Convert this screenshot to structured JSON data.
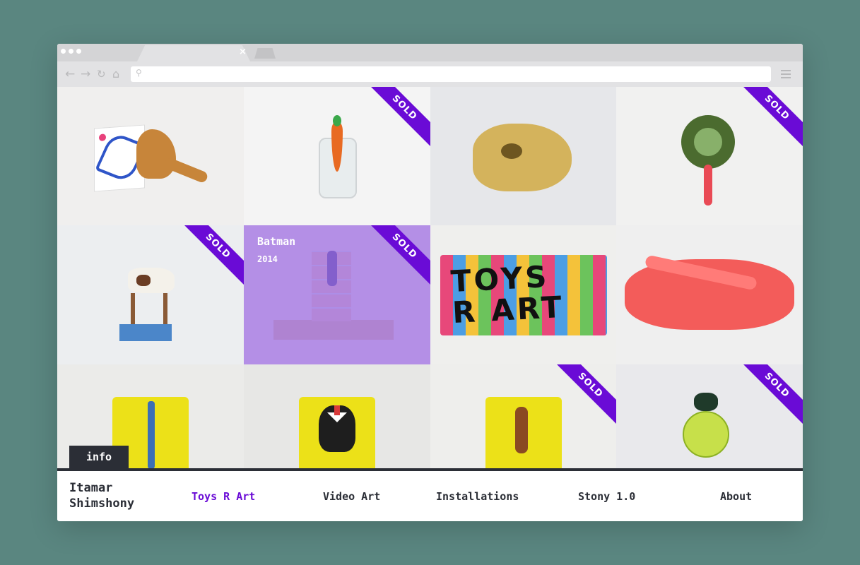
{
  "browser": {
    "tab_close_glyph": "×",
    "back_glyph": "←",
    "forward_glyph": "→",
    "reload_glyph": "↻",
    "home_glyph": "⌂",
    "search_glyph": "⚲",
    "url_value": ""
  },
  "gallery": {
    "sold_label": "SOLD",
    "hover": {
      "title": "Batman",
      "year": "2014"
    },
    "tiles": [
      {
        "name": "tile-dinosaur-painting",
        "sold": false,
        "bg": "#f0efee"
      },
      {
        "name": "tile-carrot-jar",
        "sold": true,
        "bg": "#f4f4f4"
      },
      {
        "name": "tile-gold-sculpture",
        "sold": false,
        "bg": "#e6e7ea"
      },
      {
        "name": "tile-chia-head",
        "sold": true,
        "bg": "#f1f1f0"
      },
      {
        "name": "tile-toy-horse",
        "sold": true,
        "bg": "#eceef0"
      },
      {
        "name": "tile-batman-blocks",
        "sold": true,
        "bg": "#e8e6e4"
      },
      {
        "name": "tile-toys-r-art-cards",
        "sold": false,
        "bg": "#efefed"
      },
      {
        "name": "tile-red-sculpture",
        "sold": false,
        "bg": "#efefef"
      },
      {
        "name": "tile-yellow-foam-tool",
        "sold": false,
        "bg": "#ebebe9"
      },
      {
        "name": "tile-yellow-foam-helmet",
        "sold": false,
        "bg": "#e7e7e5"
      },
      {
        "name": "tile-yellow-foam-insect",
        "sold": true,
        "bg": "#eeeeec"
      },
      {
        "name": "tile-tennis-ball-gator",
        "sold": true,
        "bg": "#e9e9ec"
      }
    ]
  },
  "info_label": "info",
  "footer": {
    "brand_line1": "Itamar",
    "brand_line2": "Shimshony",
    "nav": [
      {
        "label": "Toys R Art",
        "active": true
      },
      {
        "label": "Video Art",
        "active": false
      },
      {
        "label": "Installations",
        "active": false
      },
      {
        "label": "Stony 1.0",
        "active": false
      },
      {
        "label": "About",
        "active": false
      }
    ]
  },
  "colors": {
    "accent": "#6a0bd6",
    "dark": "#2b2e36",
    "background": "#5a8680"
  }
}
